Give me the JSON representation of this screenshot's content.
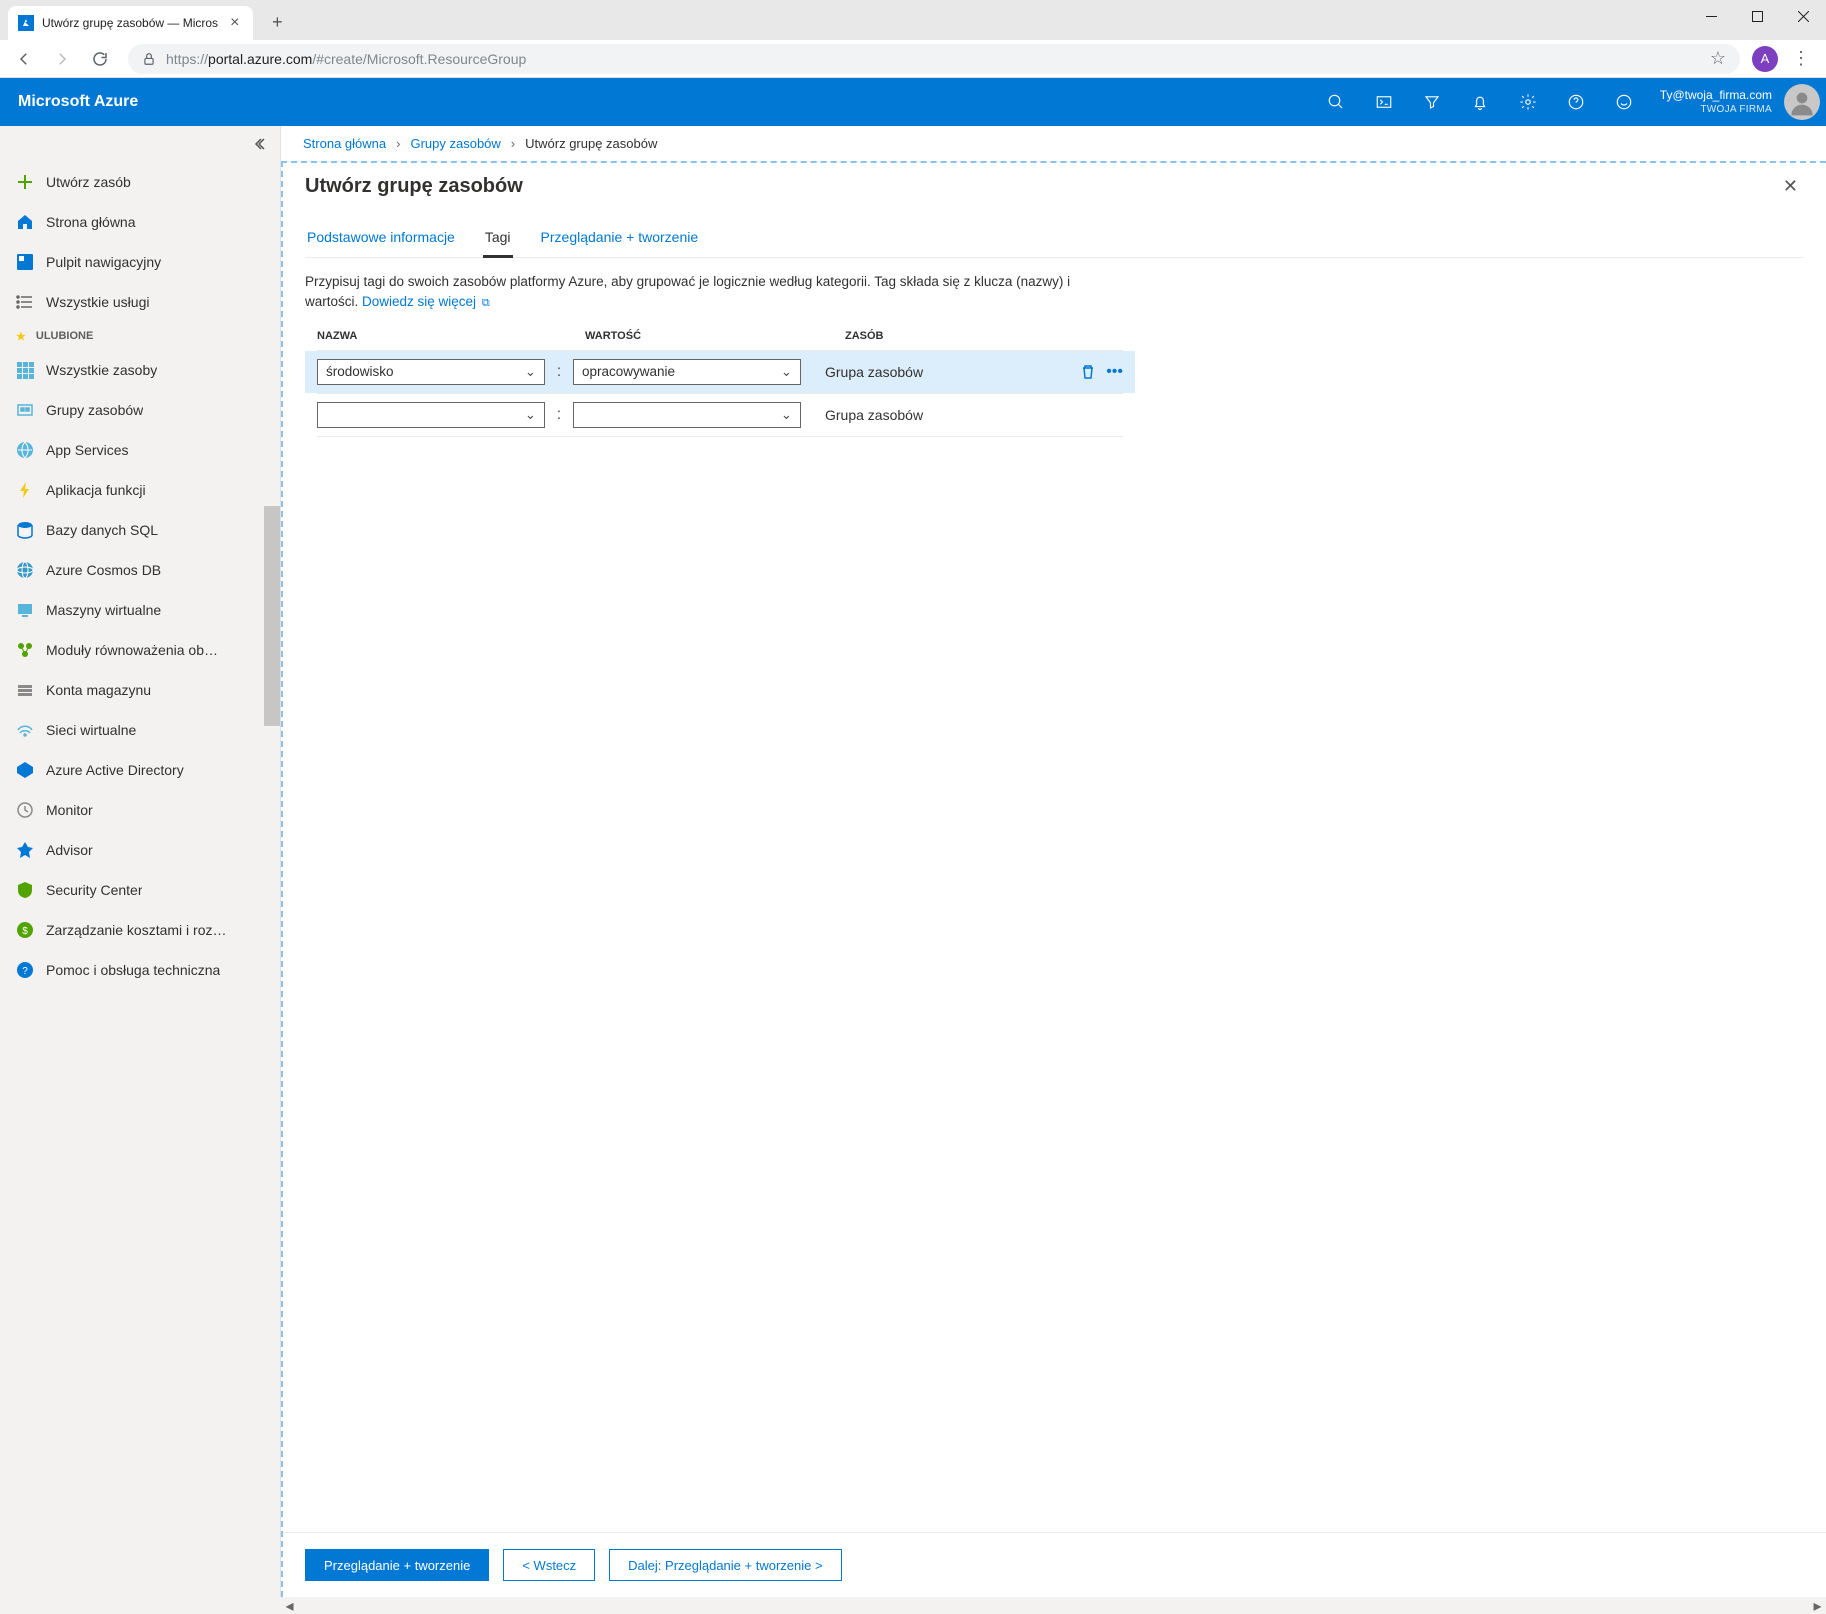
{
  "browser": {
    "tab_title": "Utwórz grupę zasobów — Micros",
    "url_prefix": "https://",
    "url_host": "portal.azure.com",
    "url_path": "/#create/Microsoft.ResourceGroup",
    "avatar_letter": "A"
  },
  "topbar": {
    "brand": "Microsoft Azure",
    "account_email": "Ty@twoja_firma.com",
    "account_org": "TWOJA FIRMA"
  },
  "sidebar": {
    "create": "Utwórz zasób",
    "home": "Strona główna",
    "dashboard": "Pulpit nawigacyjny",
    "all_services": "Wszystkie usługi",
    "fav_header": "ULUBIONE",
    "items": [
      "Wszystkie zasoby",
      "Grupy zasobów",
      "App Services",
      "Aplikacja funkcji",
      "Bazy danych SQL",
      "Azure Cosmos DB",
      "Maszyny wirtualne",
      "Moduły równoważenia ob…",
      "Konta magazynu",
      "Sieci wirtualne",
      "Azure Active Directory",
      "Monitor",
      "Advisor",
      "Security Center",
      "Zarządzanie kosztami i roz…",
      "Pomoc i obsługa techniczna"
    ]
  },
  "breadcrumb": {
    "home": "Strona główna",
    "groups": "Grupy zasobów",
    "current": "Utwórz grupę zasobów"
  },
  "blade": {
    "title": "Utwórz grupę zasobów",
    "tabs": {
      "basics": "Podstawowe informacje",
      "tags": "Tagi",
      "review": "Przeglądanie + tworzenie"
    },
    "desc_text": "Przypisuj tagi do swoich zasobów platformy Azure, aby grupować je logicznie według kategorii. Tag składa się z klucza (nazwy) i wartości. ",
    "learn_more": "Dowiedz się więcej",
    "headers": {
      "name": "NAZWA",
      "value": "WARTOŚĆ",
      "resource": "ZASÓB"
    },
    "rows": [
      {
        "name": "środowisko",
        "value": "opracowywanie",
        "resource": "Grupa zasobów",
        "selected": true
      },
      {
        "name": "",
        "value": "",
        "resource": "Grupa zasobów",
        "selected": false
      }
    ],
    "footer": {
      "review": "Przeglądanie + tworzenie",
      "back": "<  Wstecz",
      "next": "Dalej: Przeglądanie + tworzenie  >"
    }
  }
}
